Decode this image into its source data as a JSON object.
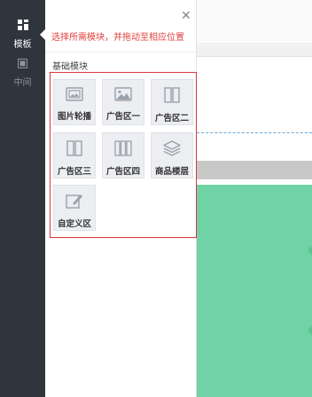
{
  "rail": {
    "items": [
      {
        "label": "模板",
        "icon": "template-grid-icon",
        "active": true
      },
      {
        "label": "中间",
        "icon": "layout-box-icon",
        "active": false
      }
    ]
  },
  "panel": {
    "hint": "选择所需模块，并拖动至相应位置",
    "section_title": "基础模块",
    "close_icon": "close-icon",
    "modules": [
      {
        "label": "图片轮播",
        "icon": "image-carousel-icon"
      },
      {
        "label": "广告区一",
        "icon": "image-icon"
      },
      {
        "label": "广告区二",
        "icon": "two-column-icon"
      },
      {
        "label": "广告区三",
        "icon": "two-column-icon"
      },
      {
        "label": "广告区四",
        "icon": "three-column-icon"
      },
      {
        "label": "商品楼层",
        "icon": "layers-icon"
      },
      {
        "label": "自定义区",
        "icon": "edit-icon"
      }
    ]
  },
  "colors": {
    "rail_bg": "#2f353d",
    "hint_text": "#e0423e",
    "modules_border": "#d9363e",
    "canvas_green": "#6fd3a5"
  }
}
